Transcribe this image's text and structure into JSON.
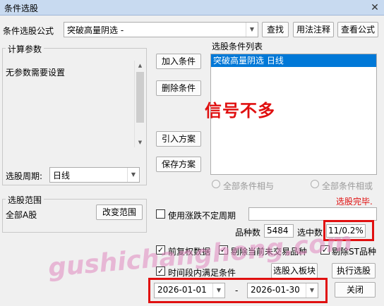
{
  "window": {
    "title": "条件选股",
    "close_glyph": "✕"
  },
  "formula": {
    "label": "条件选股公式",
    "value": "突破高量阴选  -",
    "buttons": {
      "find": "查找",
      "usage": "用法注释",
      "view": "查看公式"
    }
  },
  "params": {
    "title": "计算参数",
    "text": "无参数需要设置"
  },
  "period": {
    "label": "选股周期:",
    "value": "日线"
  },
  "middle_buttons": {
    "add": "加入条件",
    "delete": "删除条件",
    "import": "引入方案",
    "save": "保存方案"
  },
  "conditions": {
    "title": "选股条件列表",
    "items": [
      "突破高量阴选  日线"
    ]
  },
  "overlay_text": "信号不多",
  "logic": {
    "and_label": "全部条件相与",
    "or_label": "全部条件相或"
  },
  "status": "选股完毕.",
  "range": {
    "title": "选股范围",
    "value": "全部A股",
    "change_button": "改变范围"
  },
  "options": {
    "variable_period": {
      "label": "使用涨跌不定周期",
      "checked": false
    },
    "stock_count_label": "品种数",
    "stock_count": "5484",
    "selected_label": "选中数",
    "selected_value": "11/0.2%",
    "fq": {
      "label": "前复权数据",
      "checked": true
    },
    "exclude_untraded": {
      "label": "剔除当前未交易品种",
      "checked": true
    },
    "exclude_st": {
      "label": "剔除ST品种",
      "checked": true
    },
    "time_period": {
      "label": "时间段内满足条件",
      "checked": true
    }
  },
  "actions": {
    "to_block": "选股入板块",
    "execute": "执行选股",
    "close": "关闭"
  },
  "dates": {
    "start": "2026-01-01",
    "separator": "-",
    "end": "2026-01-30"
  },
  "watermark": "gushichanghong.com",
  "icons": {
    "dropdown": "▼",
    "scroll_up": "▲",
    "scroll_down": "▼",
    "check": "✓"
  }
}
